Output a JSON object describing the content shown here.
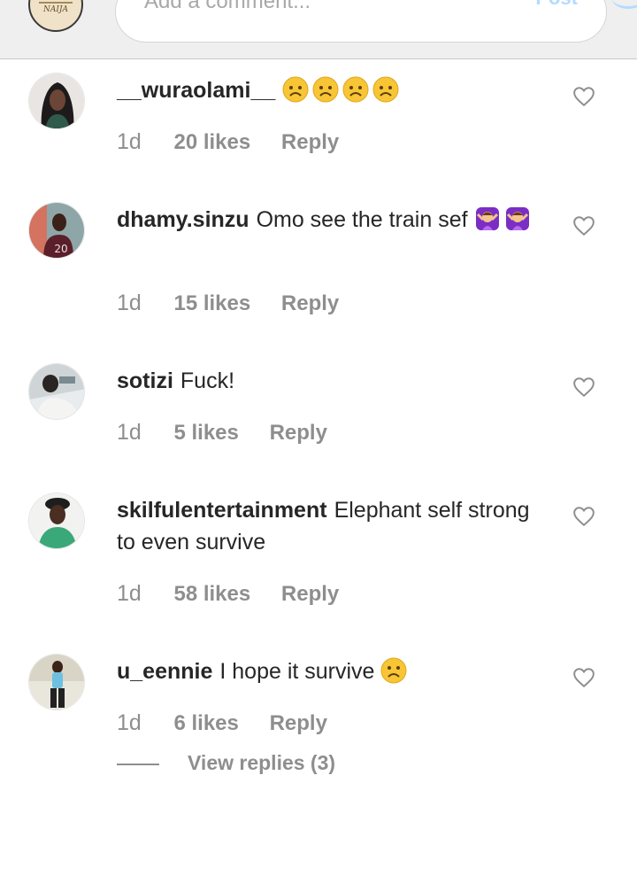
{
  "composer": {
    "avatar_text": "NAIJA",
    "placeholder": "Add a comment...",
    "post_label": "Post"
  },
  "comments": [
    {
      "username": "__wuraolami__",
      "text": "",
      "emoji_count": 4,
      "time": "1d",
      "likes": "20 likes",
      "reply": "Reply"
    },
    {
      "username": "dhamy.sinzu",
      "text": "Omo see the train sef",
      "time": "1d",
      "likes": "15 likes",
      "reply": "Reply"
    },
    {
      "username": "sotizi",
      "text": "Fuck!",
      "time": "1d",
      "likes": "5 likes",
      "reply": "Reply"
    },
    {
      "username": "skilfulentertainment",
      "text": "Elephant self strong to even survive",
      "time": "1d",
      "likes": "58 likes",
      "reply": "Reply"
    },
    {
      "username": "u_eennie",
      "text": "I hope it survive",
      "time": "1d",
      "likes": "6 likes",
      "reply": "Reply"
    }
  ],
  "view_replies": "View replies (3)",
  "colors": {
    "accent": "#b3dbff",
    "muted": "#8e8e8e",
    "text": "#262626"
  }
}
